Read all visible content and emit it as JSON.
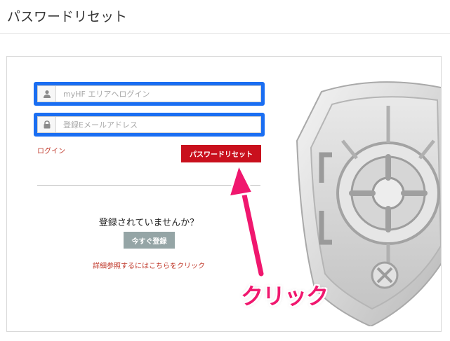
{
  "header": {
    "title": "パスワードリセット"
  },
  "form": {
    "username": {
      "placeholder": "myHF エリアへログイン",
      "icon": "user-icon"
    },
    "email": {
      "placeholder": "登録Eメールアドレス",
      "icon": "lock-icon"
    },
    "login_link": "ログイン",
    "reset_button": "パスワードリセット"
  },
  "register": {
    "prompt": "登録されていませんか？",
    "button": "今すぐ登録",
    "details_link": "詳細参照するにはこちらをクリック"
  },
  "annotation": {
    "label": "クリック",
    "color": "#f0176e"
  },
  "colors": {
    "highlight": "#1a6ef2",
    "primary": "#c9101d",
    "secondary": "#95a5a6",
    "link": "#c0392b"
  }
}
